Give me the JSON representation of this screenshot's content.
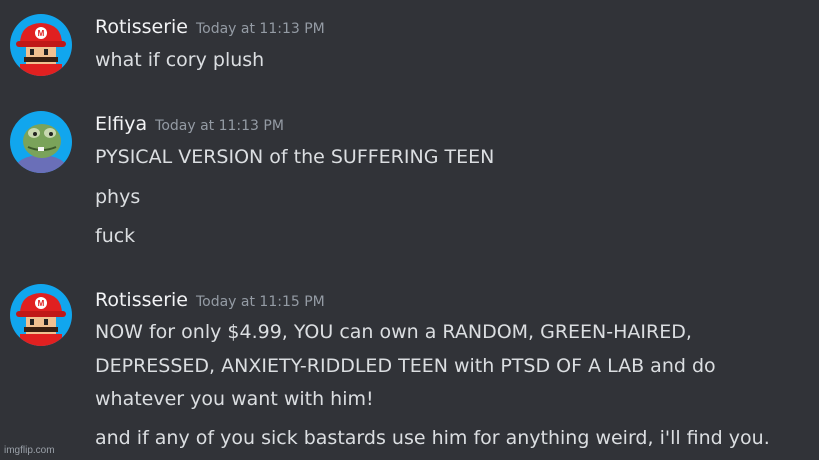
{
  "messages": [
    {
      "username": "Rotisserie",
      "timestamp": "Today at 11:13 PM",
      "avatar": "mario-avatar",
      "lines": [
        "what if cory plush"
      ]
    },
    {
      "username": "Elfiya",
      "timestamp": "Today at 11:13 PM",
      "avatar": "frog-avatar",
      "lines": [
        "PYSICAL VERSION of the SUFFERING TEEN",
        "phys",
        "fuck"
      ]
    },
    {
      "username": "Rotisserie",
      "timestamp": "Today at 11:15 PM",
      "avatar": "mario-avatar",
      "lines": [
        "NOW for only $4.99, YOU can own a RANDOM, GREEN-HAIRED,",
        "DEPRESSED, ANXIETY-RIDDLED TEEN with PTSD OF A LAB and do",
        "whatever you want with him!",
        "and if any of you sick bastards use him for anything weird, i'll find you."
      ]
    }
  ],
  "watermark": "imgflip.com",
  "colors": {
    "background": "#313338",
    "username": "#f2f3f5",
    "timestamp": "#949ba4",
    "text": "#dbdee1",
    "avatar_bg": "#11a6ee"
  }
}
